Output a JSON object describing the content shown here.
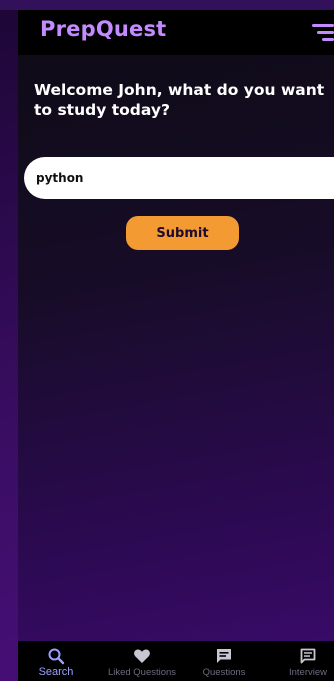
{
  "app": {
    "title": "PrepQuest",
    "menu_icon": "hamburger-menu-icon"
  },
  "main": {
    "welcome_text": "Welcome John, what do you want to study today?",
    "search": {
      "value": "python",
      "placeholder": ""
    },
    "submit_label": "Submit"
  },
  "tabbar": {
    "tabs": [
      {
        "label": "Search",
        "icon": "search-icon",
        "active": true
      },
      {
        "label": "Liked Questions",
        "icon": "heart-icon",
        "active": false
      },
      {
        "label": "Questions",
        "icon": "chat-bubble-icon",
        "active": false
      },
      {
        "label": "Interview",
        "icon": "message-square-icon",
        "active": false
      }
    ]
  },
  "colors": {
    "brand_purple": "#c38bff",
    "accent_orange": "#f39a33",
    "active_tab": "#9aa0ff",
    "inactive_tab": "#6f6a80",
    "header_bg": "#000000"
  }
}
